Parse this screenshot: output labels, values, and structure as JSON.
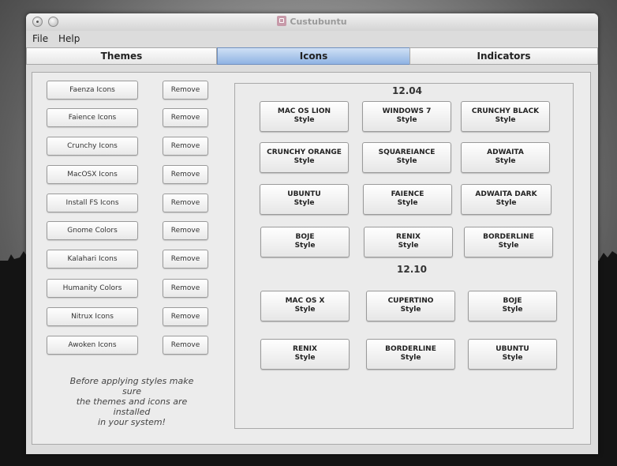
{
  "window": {
    "title": "Custubuntu"
  },
  "menu": [
    "File",
    "Help"
  ],
  "tabs": [
    "Themes",
    "Icons",
    "Indicators"
  ],
  "active_tab": "Icons",
  "left_items": [
    {
      "label": "Faenza Icons",
      "remove": "Remove"
    },
    {
      "label": "Faience Icons",
      "remove": "Remove"
    },
    {
      "label": "Crunchy Icons",
      "remove": "Remove"
    },
    {
      "label": "MacOSX Icons",
      "remove": "Remove"
    },
    {
      "label": "Install FS Icons",
      "remove": "Remove"
    },
    {
      "label": "Gnome Colors",
      "remove": "Remove"
    },
    {
      "label": "Kalahari Icons",
      "remove": "Remove"
    },
    {
      "label": "Humanity Colors",
      "remove": "Remove"
    },
    {
      "label": "Nitrux Icons",
      "remove": "Remove"
    },
    {
      "label": "Awoken Icons",
      "remove": "Remove"
    }
  ],
  "hint_lines": [
    "Before applying styles make sure",
    "the themes and icons are installed",
    "in your system!"
  ],
  "versions": [
    {
      "label": "12.04",
      "styles": [
        {
          "name": "MAC OS LION",
          "sub": "Style"
        },
        {
          "name": "WINDOWS 7",
          "sub": "Style"
        },
        {
          "name": "CRUNCHY BLACK",
          "sub": "Style"
        },
        {
          "name": "CRUNCHY ORANGE",
          "sub": "Style"
        },
        {
          "name": "SQUAREIANCE",
          "sub": "Style"
        },
        {
          "name": "ADWAITA",
          "sub": "Style"
        },
        {
          "name": "UBUNTU",
          "sub": "Style"
        },
        {
          "name": "FAIENCE",
          "sub": "Style"
        },
        {
          "name": "ADWAITA DARK",
          "sub": "Style"
        },
        {
          "name": "BOJE",
          "sub": "Style"
        },
        {
          "name": "RENIX",
          "sub": "Style"
        },
        {
          "name": "BORDERLINE",
          "sub": "Style"
        }
      ]
    },
    {
      "label": "12.10",
      "styles": [
        {
          "name": "MAC OS X",
          "sub": "Style"
        },
        {
          "name": "CUPERTINO",
          "sub": "Style"
        },
        {
          "name": "BOJE",
          "sub": "Style"
        },
        {
          "name": "RENIX",
          "sub": "Style"
        },
        {
          "name": "BORDERLINE",
          "sub": "Style"
        },
        {
          "name": "UBUNTU",
          "sub": "Style"
        }
      ]
    }
  ]
}
